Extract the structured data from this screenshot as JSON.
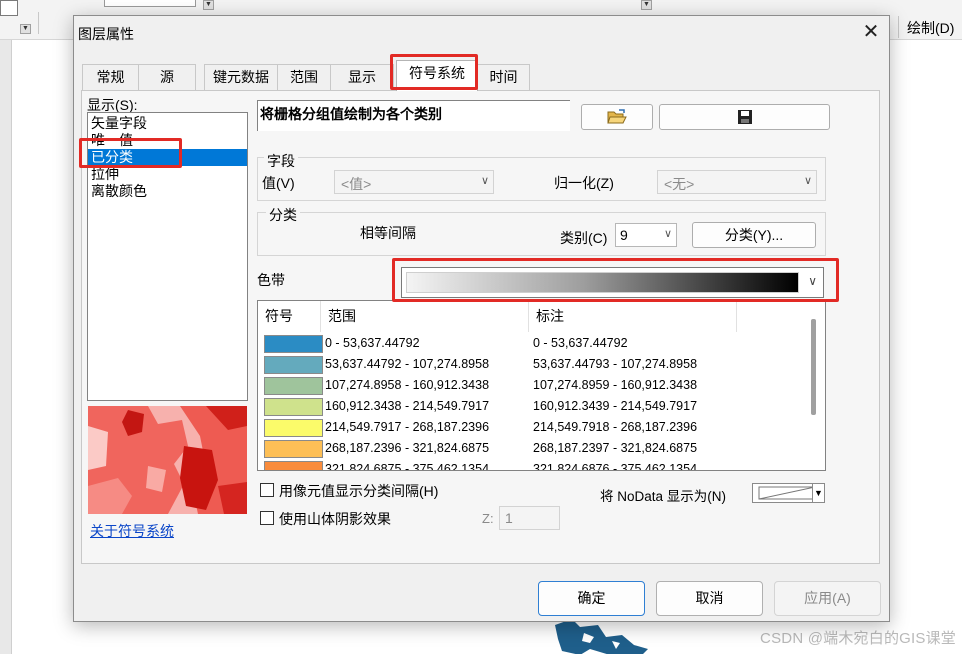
{
  "background": {
    "toolbar_right_label": "绘制(D)",
    "watermark": "CSDN @端木宛白的GIS课堂"
  },
  "dialog": {
    "title": "图层属性",
    "close_glyph": "✕",
    "tabs": [
      "常规",
      "源",
      "键元数据",
      "范围",
      "显示",
      "符号系统",
      "时间"
    ],
    "active_tab": "符号系统",
    "show_label": "显示(S):",
    "renderer_list": [
      "矢量字段",
      "唯一值",
      "已分类",
      "拉伸",
      "离散颜色"
    ],
    "selected_renderer": "已分类",
    "about_link": "关于符号系统",
    "description": "将栅格分组值绘制为各个类别",
    "open_icon": "folder-open-icon",
    "save_icon": "floppy-save-icon",
    "field_group": {
      "title": "字段",
      "value_label": "值(V)",
      "value_selected": "<值>",
      "normalize_label": "归一化(Z)",
      "normalize_selected": "<无>"
    },
    "classify_group": {
      "title": "分类",
      "method": "相等间隔",
      "classes_label": "类别(C)",
      "classes_value": "9",
      "classify_button": "分类(Y)..."
    },
    "color_ramp_label": "色带",
    "table": {
      "columns": [
        "符号",
        "范围",
        "标注"
      ],
      "rows": [
        {
          "color": "#2b8cc4",
          "range": "0 - 53,637.44792",
          "label": "0 - 53,637.44792"
        },
        {
          "color": "#64aabd",
          "range": "53,637.44792 - 107,274.8958",
          "label": "53,637.44793 - 107,274.8958"
        },
        {
          "color": "#9fc49c",
          "range": "107,274.8958 - 160,912.3438",
          "label": "107,274.8959 - 160,912.3438"
        },
        {
          "color": "#cfe28c",
          "range": "160,912.3438 - 214,549.7917",
          "label": "160,912.3439 - 214,549.7917"
        },
        {
          "color": "#fbfb6a",
          "range": "214,549.7917 - 268,187.2396",
          "label": "214,549.7918 - 268,187.2396"
        },
        {
          "color": "#fdbf56",
          "range": "268,187.2396 - 321,824.6875",
          "label": "268,187.2397 - 321,824.6875"
        },
        {
          "color": "#f98c3c",
          "range": "321,824.6875 - 375,462.1354",
          "label": "321,824.6876 - 375,462.1354"
        }
      ]
    },
    "show_class_breaks": "用像元值显示分类间隔(H)",
    "use_hillshade": "使用山体阴影效果",
    "z_label": "Z:",
    "z_value": "1",
    "nodata_label": "将 NoData 显示为(N)",
    "buttons": {
      "ok": "确定",
      "cancel": "取消",
      "apply": "应用(A)"
    }
  },
  "colors": {
    "highlight_red": "#e22a25",
    "selection_blue": "#0078d7",
    "link_blue": "#0b46c8"
  }
}
